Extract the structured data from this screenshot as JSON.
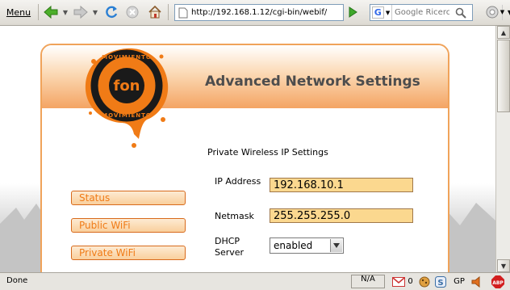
{
  "browser": {
    "menu_label": "Menu",
    "url": "http://192.168.1.12/cgi-bin/webif/",
    "search_placeholder": "Google Ricerca",
    "search_engine_glyph": "G"
  },
  "page": {
    "title": "Advanced Network Settings",
    "section_heading": "Private Wireless IP Settings",
    "logo_text": "MOVIMIENTO fon MOVIMIENTO",
    "nav": [
      {
        "label": "Status"
      },
      {
        "label": "Public WiFi"
      },
      {
        "label": "Private WiFi"
      }
    ],
    "form": {
      "ip_label": "IP Address",
      "ip_value": "192.168.10.1",
      "netmask_label": "Netmask",
      "netmask_value": "255.255.255.0",
      "dhcp_label": "DHCP Server",
      "dhcp_value": "enabled"
    }
  },
  "statusbar": {
    "text": "Done",
    "na_label": "N/A",
    "mail_count": "0",
    "gp_label": "GP",
    "adblock_label": "ABP"
  },
  "colors": {
    "accent_orange": "#f07b16",
    "field_fill": "#fbd88f",
    "panel_border": "#f0a35a"
  }
}
